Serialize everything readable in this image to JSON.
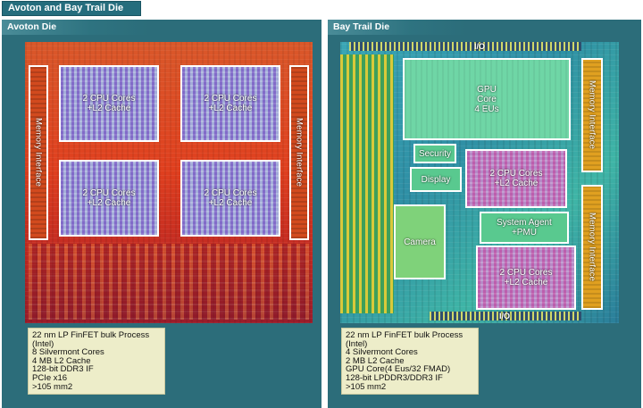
{
  "header": {
    "title": "Avoton and Bay Trail Die"
  },
  "avoton": {
    "title": "Avoton Die",
    "cpu_label_1": "2 CPU Cores",
    "cpu_label_2": "+L2 Cache",
    "memory_label": "Memory Interface",
    "specs": [
      "22 nm LP FinFET bulk Process",
      "(Intel)",
      "8 Silvermont Cores",
      "4 MB L2 Cache",
      "128-bit DDR3 IF",
      "PCIe x16",
      ">105 mm2"
    ]
  },
  "baytrail": {
    "title": "Bay Trail Die",
    "io_label": "I/O",
    "gpu_label_1": "GPU",
    "gpu_label_2": "Core",
    "gpu_label_3": "4 EUs",
    "security_label": "Security",
    "display_label": "Display",
    "camera_label": "Camera",
    "system_agent_1": "System Agent",
    "system_agent_2": "+PMU",
    "cpu_label_1": "2 CPU Cores",
    "cpu_label_2": "+L2 Cache",
    "memory_label": "Memory Interface",
    "specs": [
      "22 nm LP FinFET bulk Process",
      "(Intel)",
      "4 Silvermont Cores",
      "2 MB L2 Cache",
      "GPU Core(4 Eus/32 FMAD)",
      "128-bit LPDDR3/DDR3 IF",
      ">105 mm2"
    ]
  },
  "colors": {
    "panel_bg": "#2c6d7a",
    "notes_bg": "#ededc9",
    "avoton_die": "#e0401f",
    "baytrail_die": "#2f8fa5"
  }
}
